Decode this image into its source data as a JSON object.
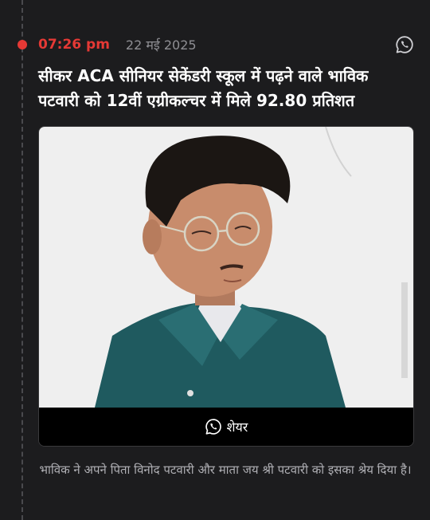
{
  "post": {
    "time": "07:26 pm",
    "date": "22 मई 2025",
    "headline": "सीकर ACA सीनियर सेकेंडरी स्कूल में पढ़ने वाले भाविक पटवारी को 12वीं एग्रीकल्चर में मिले 92.80 प्रतिशत",
    "share_label": "शेयर",
    "caption": "भाविक ने अपने पिता विनोद पटवारी और माता जय श्री पटवारी को इसका श्रेय दिया है।"
  },
  "icons": {
    "top_right": "whatsapp-icon",
    "share": "whatsapp-icon"
  },
  "colors": {
    "accent": "#e53935",
    "background": "#1c1c1e",
    "date_text": "#8e8e93",
    "caption_text": "#b0b0b5"
  }
}
